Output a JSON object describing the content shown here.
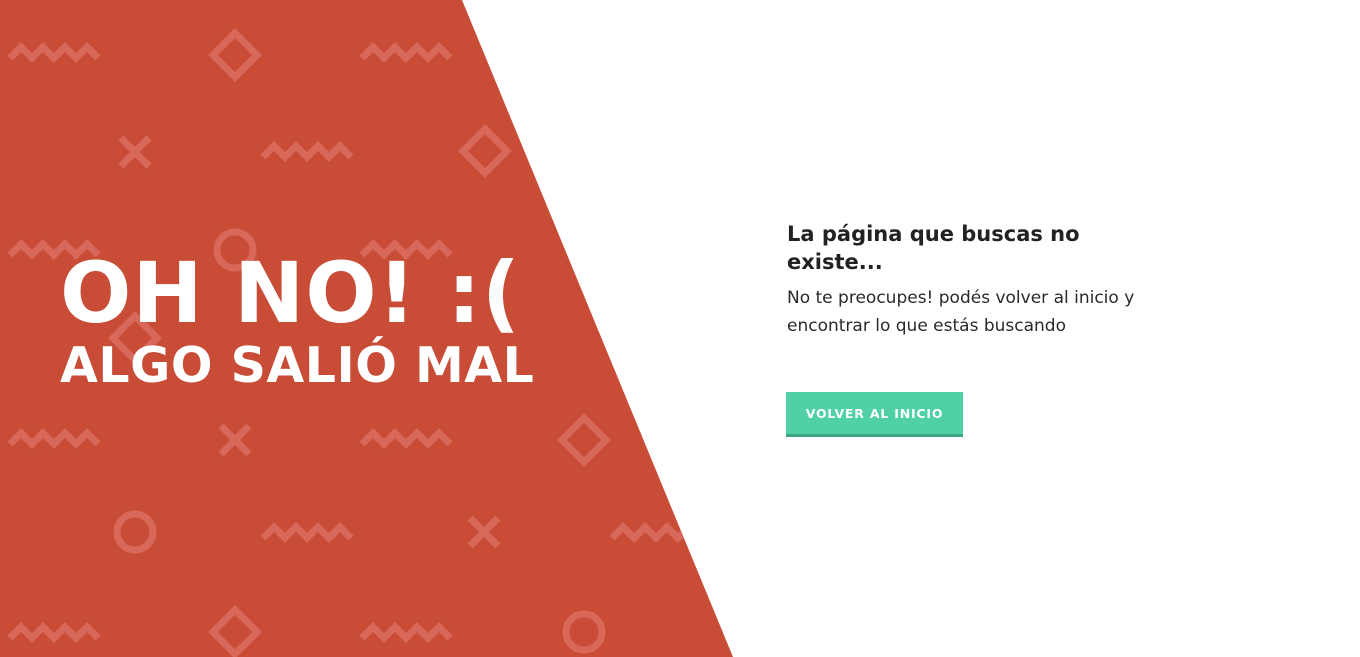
{
  "hero": {
    "title": "OH NO! :(",
    "subtitle": "ALGO SALIÓ MAL",
    "background_color": "#c94c37",
    "pattern_color": "#d86d5c"
  },
  "message": {
    "heading": "La página que buscas no existe...",
    "body": "No te preocupes! podés volver al inicio y encontrar lo que estás buscando"
  },
  "actions": {
    "home_button_label": "VOLVER AL INICIO",
    "home_button_color": "#4fd1a5"
  }
}
